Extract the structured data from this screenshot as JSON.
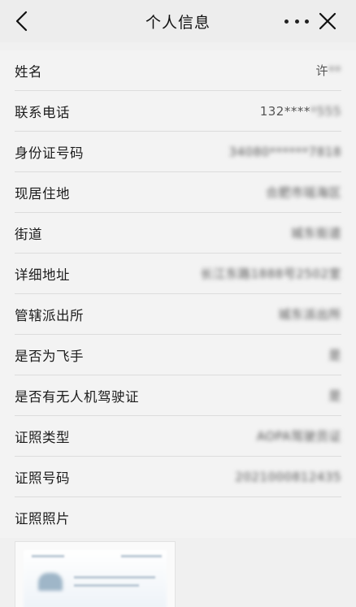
{
  "header": {
    "title": "个人信息"
  },
  "fields": [
    {
      "label": "姓名",
      "value": "许**"
    },
    {
      "label": "联系电话",
      "value": "132*****555"
    },
    {
      "label": "身份证号码",
      "value": "34080******7818"
    },
    {
      "label": "现居住地",
      "value": "合肥市瑶海区"
    },
    {
      "label": "街道",
      "value": "城东街道"
    },
    {
      "label": "详细地址",
      "value": "长江东路1888号2502室"
    },
    {
      "label": "管辖派出所",
      "value": "城东派出所"
    },
    {
      "label": "是否为飞手",
      "value": "是"
    },
    {
      "label": "是否有无人机驾驶证",
      "value": "是"
    },
    {
      "label": "证照类型",
      "value": "AOPA驾驶员证"
    },
    {
      "label": "证照号码",
      "value": "2021000812435"
    },
    {
      "label": "证照照片",
      "value": ""
    }
  ],
  "icons": {
    "back": "chevron-left-icon",
    "more": "more-dots-icon",
    "close": "close-icon"
  }
}
